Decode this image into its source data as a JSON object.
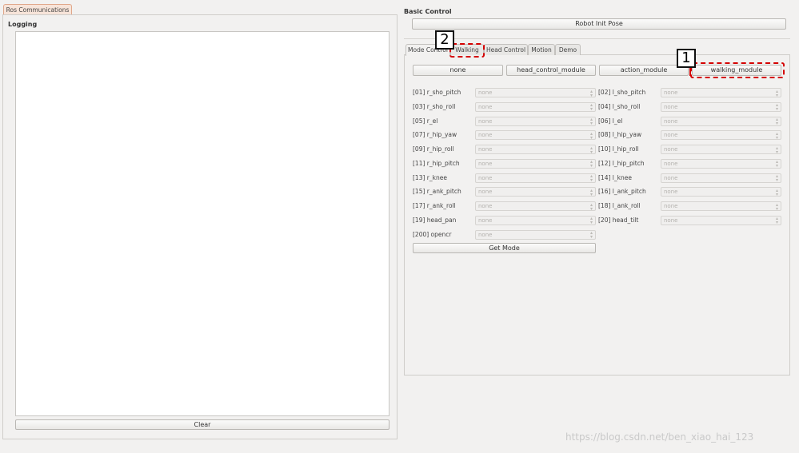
{
  "left": {
    "tab_label": "Ros Communications",
    "logging_title": "Logging",
    "clear_label": "Clear"
  },
  "right": {
    "basic_control_title": "Basic Control",
    "robot_init_pose_label": "Robot Init Pose",
    "tabs": [
      {
        "label": "Mode Control"
      },
      {
        "label": "Walking"
      },
      {
        "label": "Head Control"
      },
      {
        "label": "Motion"
      },
      {
        "label": "Demo"
      }
    ],
    "modules": [
      {
        "label": "none"
      },
      {
        "label": "head_control_module"
      },
      {
        "label": "action_module"
      },
      {
        "label": "walking_module"
      }
    ],
    "joints": [
      {
        "label": "[01] r_sho_pitch",
        "value": "none"
      },
      {
        "label": "[02] l_sho_pitch",
        "value": "none"
      },
      {
        "label": "[03] r_sho_roll",
        "value": "none"
      },
      {
        "label": "[04] l_sho_roll",
        "value": "none"
      },
      {
        "label": "[05] r_el",
        "value": "none"
      },
      {
        "label": "[06] l_el",
        "value": "none"
      },
      {
        "label": "[07] r_hip_yaw",
        "value": "none"
      },
      {
        "label": "[08] l_hip_yaw",
        "value": "none"
      },
      {
        "label": "[09] r_hip_roll",
        "value": "none"
      },
      {
        "label": "[10] l_hip_roll",
        "value": "none"
      },
      {
        "label": "[11] r_hip_pitch",
        "value": "none"
      },
      {
        "label": "[12] l_hip_pitch",
        "value": "none"
      },
      {
        "label": "[13] r_knee",
        "value": "none"
      },
      {
        "label": "[14] l_knee",
        "value": "none"
      },
      {
        "label": "[15] r_ank_pitch",
        "value": "none"
      },
      {
        "label": "[16] l_ank_pitch",
        "value": "none"
      },
      {
        "label": "[17] r_ank_roll",
        "value": "none"
      },
      {
        "label": "[18] l_ank_roll",
        "value": "none"
      },
      {
        "label": "[19] head_pan",
        "value": "none"
      },
      {
        "label": "[20] head_tilt",
        "value": "none"
      },
      {
        "label": "[200] opencr",
        "value": "none"
      }
    ],
    "get_mode_label": "Get Mode"
  },
  "annotations": {
    "callout_1": "1",
    "callout_2": "2",
    "annotation_color": "#d40000"
  },
  "watermark": "https://blog.csdn.net/ben_xiao_hai_123"
}
